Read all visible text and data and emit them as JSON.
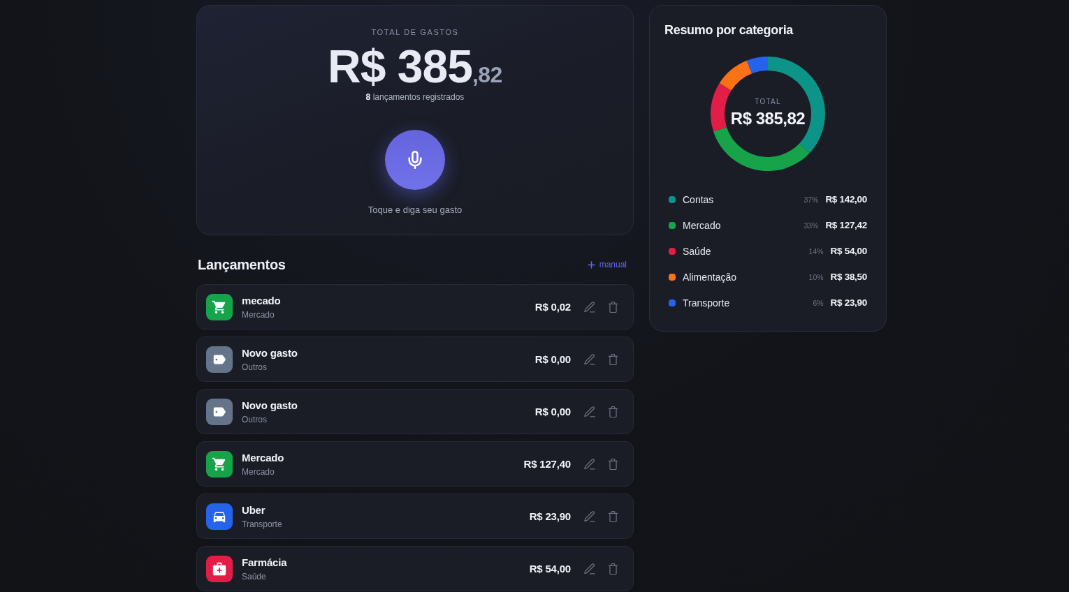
{
  "total_card": {
    "label": "TOTAL DE GASTOS",
    "amount": "R$ 385",
    "cents": ",82",
    "count_text": "**8** lançamentos registrados",
    "voice_hint": "Toque e diga seu gasto"
  },
  "entries_header": {
    "title": "Lançamentos",
    "add_link": "manual"
  },
  "entries": [
    {
      "name": "mecado",
      "category": "Mercado",
      "amount": "R$ 0,02",
      "kind": "cart",
      "color": "#16a34a"
    },
    {
      "name": "Novo gasto",
      "category": "Outros",
      "amount": "R$ 0,00",
      "kind": "tag",
      "color": "#64748b"
    },
    {
      "name": "Novo gasto",
      "category": "Outros",
      "amount": "R$ 0,00",
      "kind": "tag",
      "color": "#64748b"
    },
    {
      "name": "Mercado",
      "category": "Mercado",
      "amount": "R$ 127,40",
      "kind": "cart",
      "color": "#16a34a"
    },
    {
      "name": "Uber",
      "category": "Transporte",
      "amount": "R$ 23,90",
      "kind": "car",
      "color": "#2563eb"
    },
    {
      "name": "Farmácia",
      "category": "Saúde",
      "amount": "R$ 54,00",
      "kind": "medical",
      "color": "#e11d48"
    }
  ],
  "summary": {
    "title": "Resumo por categoria",
    "center_label": "TOTAL",
    "center_value": "R$ 385,82",
    "chart_data": {
      "type": "donut",
      "categories": [
        "Contas",
        "Mercado",
        "Saúde",
        "Alimentação",
        "Transporte"
      ],
      "values": [
        37,
        33,
        14,
        10,
        6
      ]
    },
    "legend": [
      {
        "color": "#0d9488",
        "percent": "37%",
        "amount": "R$ 142,00"
      },
      {
        "color": "#16a34a",
        "percent": "33%",
        "amount": "R$ 127,42"
      },
      {
        "color": "#e11d48",
        "percent": "14%",
        "amount": "R$ 54,00"
      },
      {
        "color": "#f97316",
        "percent": "10%",
        "amount": "R$ 38,50"
      },
      {
        "color": "#2563eb",
        "percent": "6%",
        "amount": "R$ 23,90"
      }
    ]
  }
}
